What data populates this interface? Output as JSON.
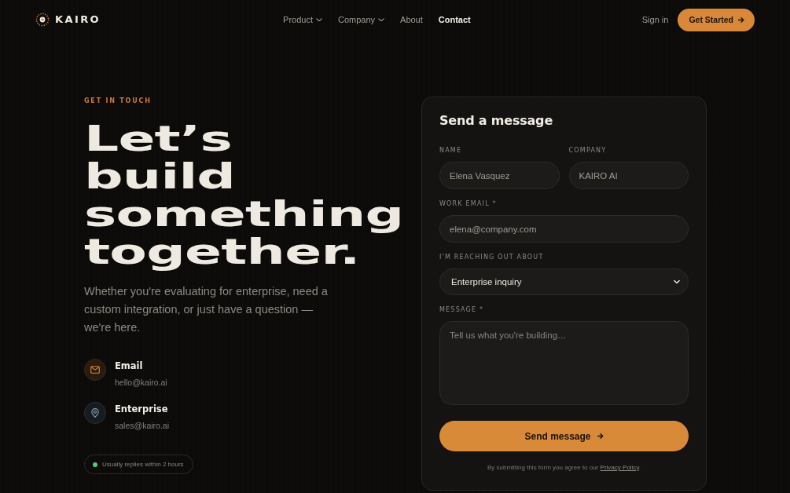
{
  "header": {
    "brand": "KAIRO",
    "nav": [
      {
        "label": "Product",
        "kind": "menu",
        "selected": false
      },
      {
        "label": "Company",
        "kind": "menu",
        "selected": false
      },
      {
        "label": "About",
        "kind": "link",
        "selected": false
      },
      {
        "label": "Contact",
        "kind": "link",
        "selected": true
      }
    ],
    "sign_in": "Sign in",
    "cta": "Get Started"
  },
  "intro": {
    "eyebrow": "GET IN TOUCH",
    "heading": "Let’s build something together.",
    "lead": "Whether you're evaluating for enterprise, need a custom integration, or just have a question — we're here."
  },
  "contacts": [
    {
      "kind": "email",
      "title": "Email",
      "detail": "hello@kairo.ai"
    },
    {
      "kind": "location",
      "title": "Enterprise",
      "detail": "sales@kairo.ai"
    }
  ],
  "reply_badge": "Usually replies within 2 hours",
  "form": {
    "title": "Send a message",
    "rows": [
      {
        "fields": [
          {
            "kind": "input",
            "label": "NAME",
            "value": "Elena Vasquez"
          },
          {
            "kind": "input",
            "label": "COMPANY",
            "value": "KAIRO AI"
          }
        ]
      },
      {
        "fields": [
          {
            "kind": "input",
            "label": "WORK EMAIL *",
            "value": "elena@company.com"
          }
        ]
      },
      {
        "fields": [
          {
            "kind": "select",
            "label": "I'M REACHING OUT ABOUT",
            "value": "Enterprise inquiry"
          }
        ]
      },
      {
        "fields": [
          {
            "kind": "textarea",
            "label": "MESSAGE *",
            "placeholder": "Tell us what you're building…"
          }
        ]
      }
    ],
    "submit": "Send message",
    "consent": {
      "text": "By submitting this form you agree to our",
      "link": "Privacy Policy",
      "after": "."
    }
  }
}
